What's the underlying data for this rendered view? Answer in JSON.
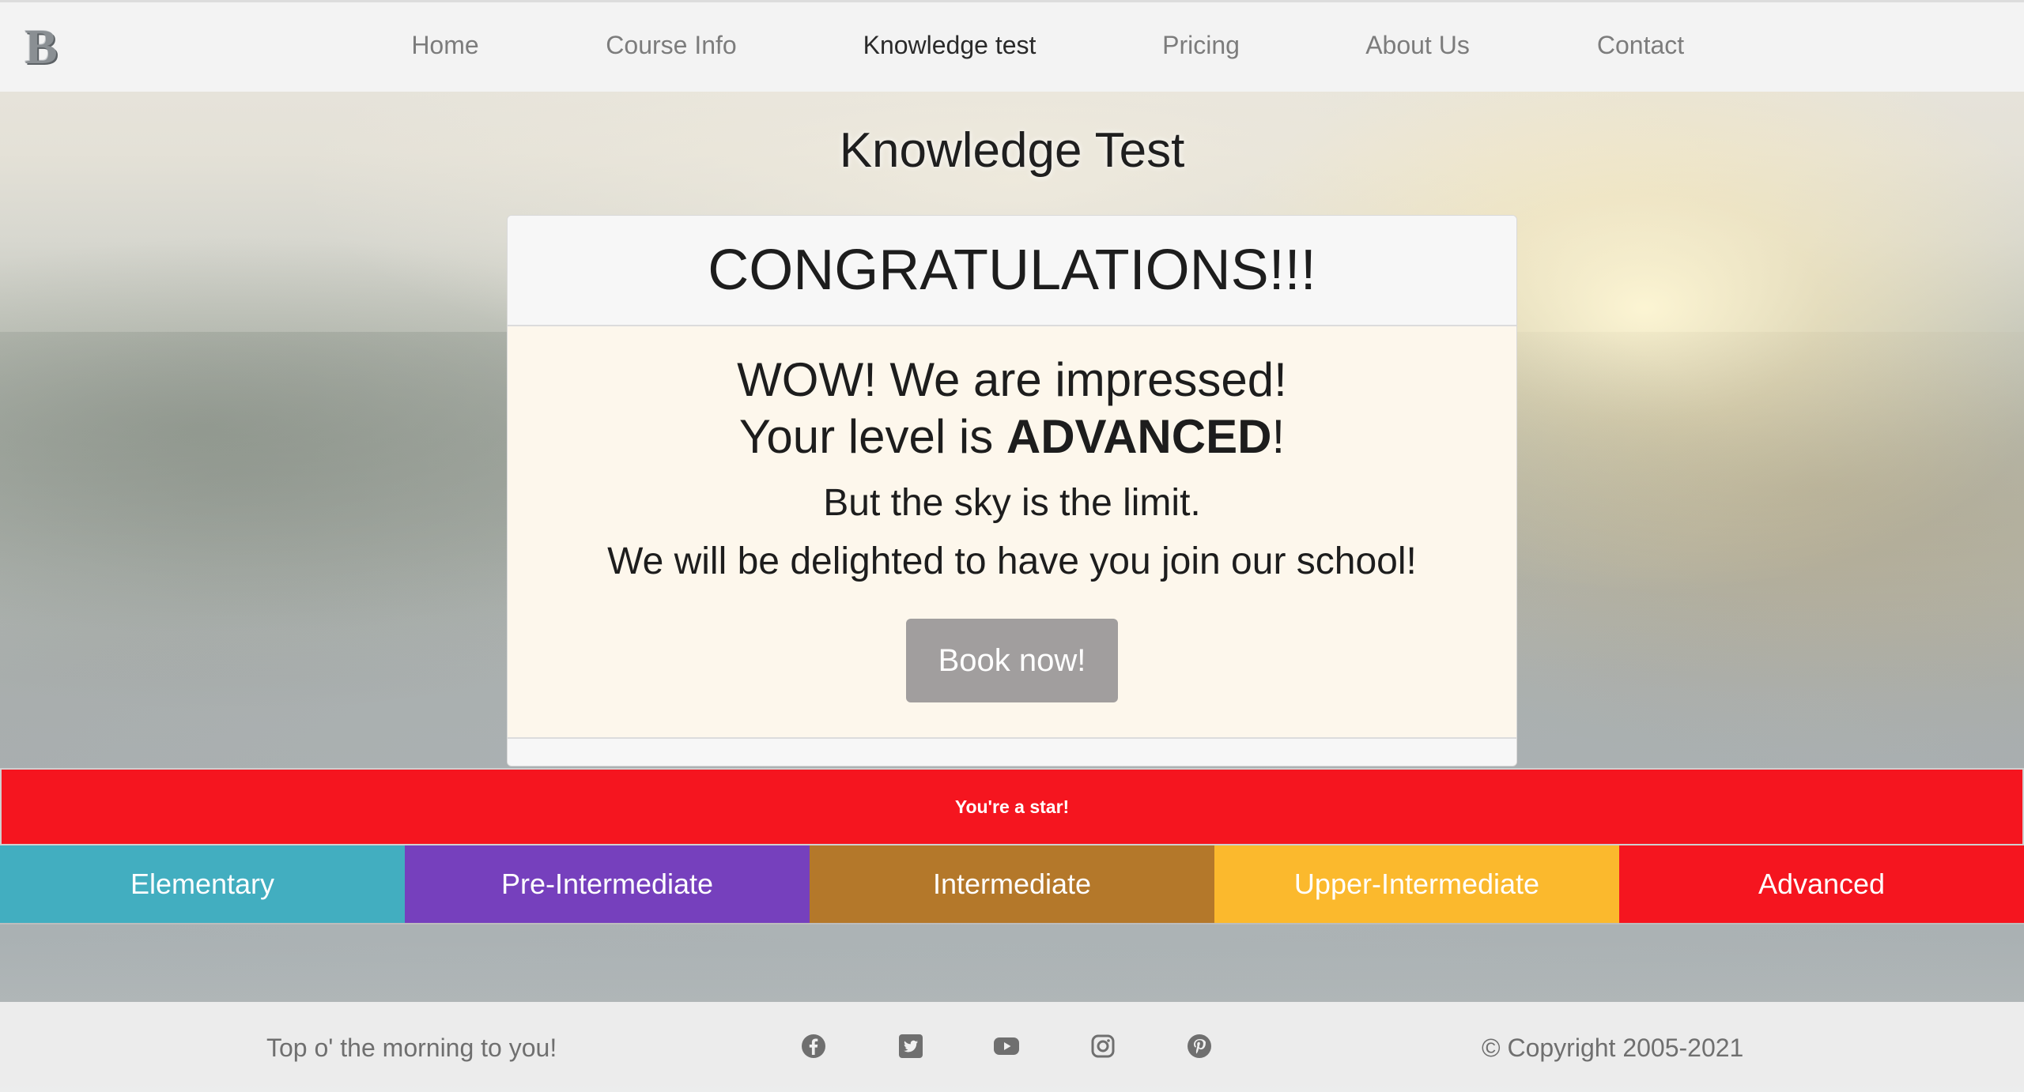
{
  "nav": {
    "brand_letter": "B",
    "links": [
      {
        "label": "Home"
      },
      {
        "label": "Course Info"
      },
      {
        "label": "Knowledge test",
        "active": true
      },
      {
        "label": "Pricing"
      },
      {
        "label": "About Us"
      },
      {
        "label": "Contact"
      }
    ]
  },
  "page": {
    "title": "Knowledge Test"
  },
  "result": {
    "header": "CONGRATULATIONS!!!",
    "wow": "WOW! We are impressed!",
    "level_prefix": "Your level is ",
    "level": "ADVANCED",
    "level_suffix": "!",
    "sky": "But the sky is the limit.",
    "join": "We will be delighted to have you join our school!",
    "button": "Book now!"
  },
  "banner": {
    "text": "You're a star!",
    "color": "#f5151f"
  },
  "levels": [
    {
      "label": "Elementary",
      "color": "#42aec0"
    },
    {
      "label": "Pre-Intermediate",
      "color": "#7640bd"
    },
    {
      "label": "Intermediate",
      "color": "#b4782a"
    },
    {
      "label": "Upper-Intermediate",
      "color": "#fbb92d"
    },
    {
      "label": "Advanced",
      "color": "#f5151f"
    }
  ],
  "footer": {
    "tagline": "Top o' the morning to you!",
    "copyright": "© Copyright 2005-2021",
    "social_icons": [
      "facebook-icon",
      "twitter-icon",
      "youtube-icon",
      "instagram-icon",
      "pinterest-icon"
    ]
  }
}
